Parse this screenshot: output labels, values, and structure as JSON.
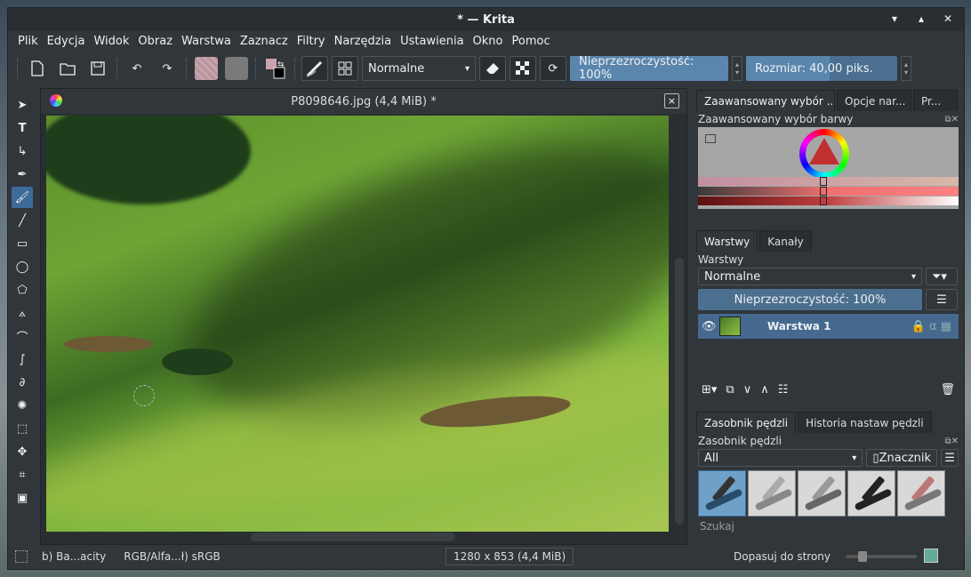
{
  "window": {
    "title": "* — Krita",
    "controls": [
      "minimize-icon",
      "maximize-icon",
      "close-icon"
    ]
  },
  "menu": [
    "Plik",
    "Edycja",
    "Widok",
    "Obraz",
    "Warstwa",
    "Zaznacz",
    "Filtry",
    "Narzędzia",
    "Ustawienia",
    "Okno",
    "Pomoc"
  ],
  "toolbar": {
    "blend_mode": "Normalne",
    "opacity_label": "Nieprzezroczystość: 100%",
    "opacity_value": 1.0,
    "size_label": "Rozmiar: 40,00 piks.",
    "size_fill": 0.55
  },
  "document": {
    "tab_title": "P8098646.jpg (4,4 MiB) *",
    "close_label": "×"
  },
  "dock": {
    "top_tabs": [
      "Zaawansowany wybór ...",
      "Opcje nar...",
      "Pr..."
    ],
    "color_panel_title": "Zaawansowany wybór barwy",
    "layers_tabs": [
      "Warstwy",
      "Kanały"
    ],
    "layers_title": "Warstwy",
    "layers_blend": "Normalne",
    "layers_opacity": "Nieprzezroczystość:  100%",
    "layer_name": "Warstwa 1",
    "brush_tabs": [
      "Zasobnik pędzli",
      "Historia nastaw pędzli"
    ],
    "brush_title": "Zasobnik pędzli",
    "brush_filter": "All",
    "brush_tag": "Znacznik",
    "search_placeholder": "Szukaj"
  },
  "status": {
    "left": "b) Ba...acity",
    "color_space": "RGB/Alfa...ł)  sRGB",
    "dimensions": "1280 x 853 (4,4 MiB)",
    "zoom_mode": "Dopasuj do strony"
  }
}
